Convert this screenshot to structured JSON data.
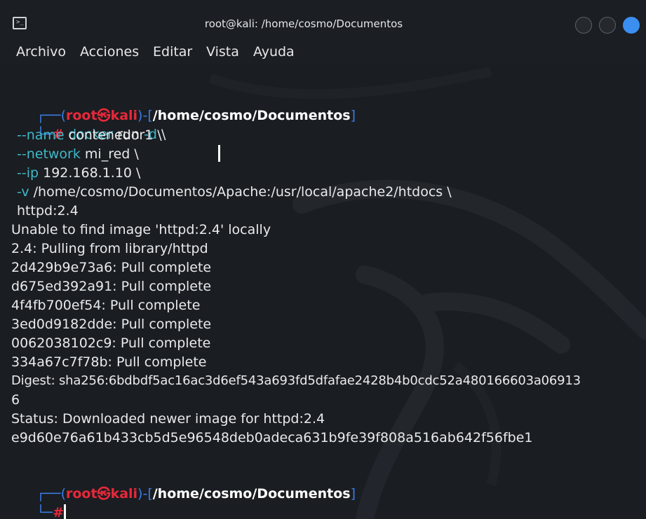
{
  "window": {
    "title": "root@kali: /home/cosmo/Documentos",
    "icons": {
      "app": "terminal-icon",
      "minimize": "minimize-icon",
      "maximize": "maximize-icon",
      "close": "close-icon"
    },
    "accent": "#3a8ff0"
  },
  "menu": {
    "items": [
      {
        "label": "Archivo"
      },
      {
        "label": "Acciones"
      },
      {
        "label": "Editar"
      },
      {
        "label": "Vista"
      },
      {
        "label": "Ayuda"
      }
    ]
  },
  "prompt": {
    "open": "┌──(",
    "user": "root",
    "at": "㉿",
    "host": "kali",
    "mid": ")-[",
    "path": "/home/cosmo/Documentos",
    "close": "]",
    "second_line_prefix": "└─",
    "hash": "#"
  },
  "command": {
    "line1": {
      "cmd": "docker",
      "rest": " run ",
      "flag": "-d",
      "tail": " \\"
    },
    "line2": {
      "flag": "--name",
      "value": " contenedor1 \\"
    },
    "line3": {
      "flag": "--network",
      "value": " mi_red \\"
    },
    "line4": {
      "flag": "--ip",
      "value": " 192.168.1.10 \\"
    },
    "line5": {
      "flag": "-v",
      "value": " /home/cosmo/Documentos/Apache:/usr/local/apache2/htdocs \\"
    },
    "line6": "httpd:2.4"
  },
  "output": [
    "Unable to find image 'httpd:2.4' locally",
    "2.4: Pulling from library/httpd",
    "2d429b9e73a6: Pull complete",
    "d675ed392a91: Pull complete",
    "4f4fb700ef54: Pull complete",
    "3ed0d9182dde: Pull complete",
    "0062038102c9: Pull complete",
    "334a67c7f78b: Pull complete",
    "Digest: sha256:6bdbdf5ac16ac3d6ef543a693fd5dfafae2428b4b0cdc52a480166603a06913",
    "6",
    "Status: Downloaded newer image for httpd:2.4",
    "e9d60e76a61b433cb5d5e96548deb0adeca631b9fe39f808a516ab642f56fbe1"
  ],
  "colors": {
    "prompt_frame": "#3b7ee6",
    "user_host": "#e8283a",
    "command": "#3fb8c8",
    "text": "#e8eaec"
  }
}
